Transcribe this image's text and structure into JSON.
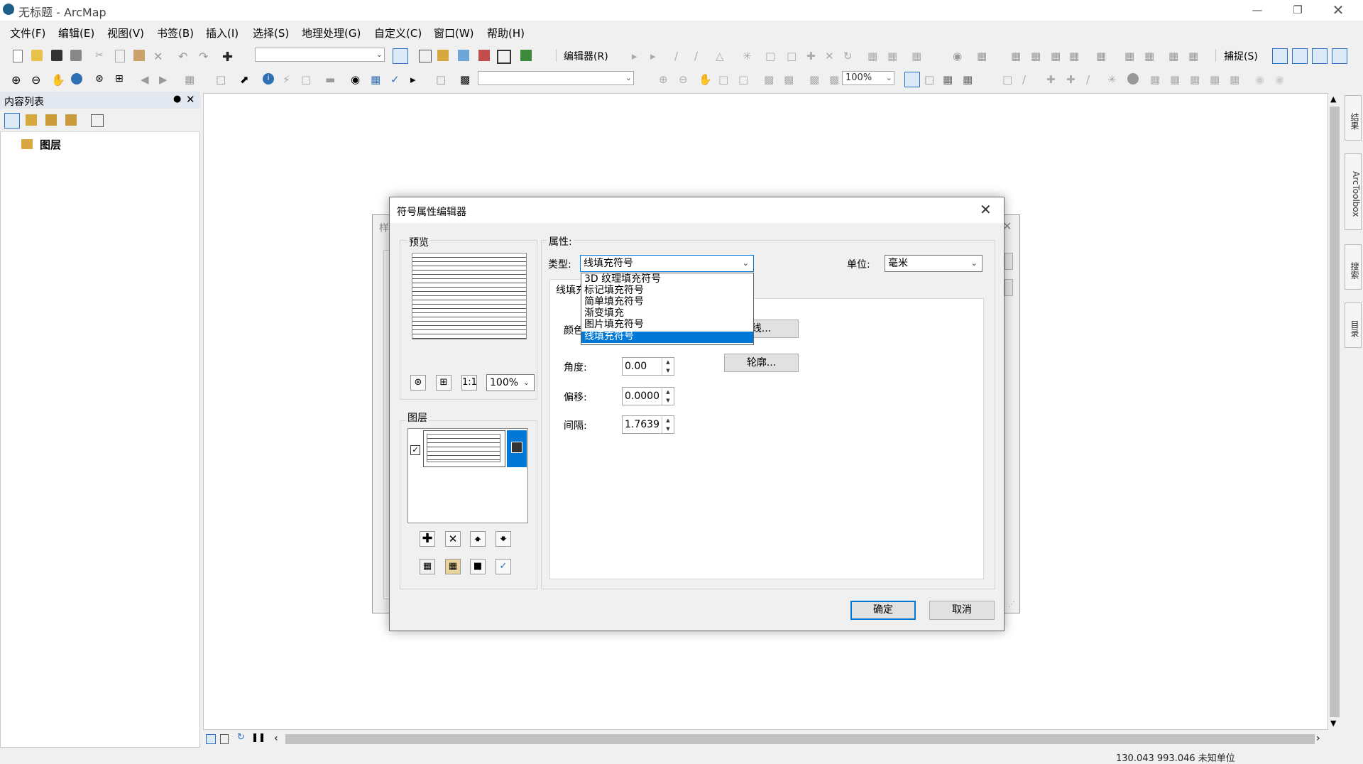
{
  "window": {
    "title": "无标题 - ArcMap"
  },
  "menu": [
    "文件(F)",
    "编辑(E)",
    "视图(V)",
    "书签(B)",
    "插入(I)",
    "选择(S)",
    "地理处理(G)",
    "自定义(C)",
    "窗口(W)",
    "帮助(H)"
  ],
  "toolbar": {
    "editor_label": "编辑器(R)",
    "snapping_label": "捕捉(S)",
    "layout_zoom": "100%"
  },
  "toc": {
    "title": "内容列表",
    "root_layer": "图层"
  },
  "dock": {
    "tabs": [
      "结果",
      "ArcToolbox",
      "搜索",
      "目录"
    ]
  },
  "status": {
    "coords": "130.043  993.046 未知单位"
  },
  "back_dialog": {
    "partial_title": "样"
  },
  "dialog": {
    "title": "符号属性编辑器",
    "preview_label": "预览",
    "preview_zoom": "100%",
    "layers_label": "图层",
    "properties_label": "属性:",
    "type_label": "类型:",
    "type_value": "线填充符号",
    "unit_label": "单位:",
    "unit_value": "毫米",
    "tab_label_partial": "线填充",
    "color_label_partial": "颜色",
    "line_button_partial": "线...",
    "outline_button": "轮廓...",
    "angle_label": "角度:",
    "angle_value": "0.00",
    "offset_label": "偏移:",
    "offset_value": "0.0000",
    "spacing_label": "间隔:",
    "spacing_value": "1.7639",
    "ok_button": "确定",
    "cancel_button": "取消",
    "type_options": [
      "3D 纹理填充符号",
      "标记填充符号",
      "简单填充符号",
      "渐变填充",
      "图片填充符号",
      "线填充符号"
    ],
    "selected_option": "线填充符号"
  }
}
